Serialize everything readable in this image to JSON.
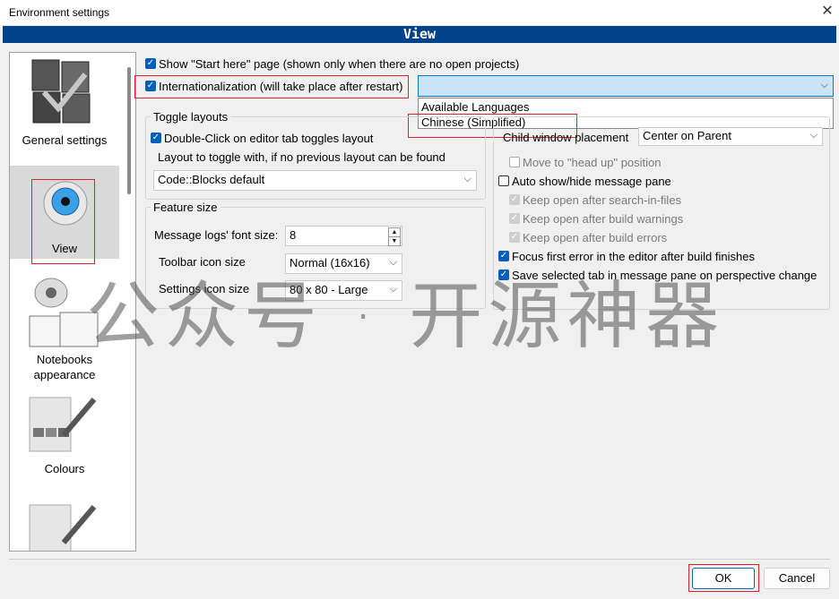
{
  "window": {
    "title": "Environment settings",
    "close_icon": "close-icon"
  },
  "header": {
    "title": "View"
  },
  "sidebar": {
    "items": [
      {
        "label": "General settings",
        "icon": "general-settings-icon"
      },
      {
        "label": "View",
        "icon": "eye-icon",
        "selected": true
      },
      {
        "label": "Notebooks appearance",
        "icon": "notebooks-icon"
      },
      {
        "label": "Colours",
        "icon": "palette-icon"
      },
      {
        "label": "",
        "icon": "palette-icon"
      }
    ]
  },
  "options": {
    "show_start_here": "Show \"Start here\" page (shown only when there are no open projects)",
    "internationalization": "Internationalization (will take place after restart)"
  },
  "language": {
    "selected": "",
    "dropdown_items": [
      "Available Languages",
      "Chinese (Simplified)"
    ]
  },
  "toggle_layouts": {
    "title": "Toggle layouts",
    "double_click": "Double-Click on editor tab toggles layout",
    "layout_hint": "Layout to toggle with, if no previous layout can be found",
    "layout_value": "Code::Blocks default"
  },
  "feature_size": {
    "title": "Feature size",
    "font_size_label": "Message logs' font size:",
    "font_size_value": "8",
    "toolbar_label": "Toolbar icon size",
    "toolbar_value": "Normal (16x16)",
    "settings_label": "Settings icon size",
    "settings_value": "80 x 80 - Large"
  },
  "right_panel": {
    "child_window_label": "Child window placement",
    "child_window_value": "Center on Parent",
    "move_head_up": "Move to \"head up\" position",
    "auto_show_hide": "Auto show/hide message pane",
    "keep_search": "Keep open after search-in-files",
    "keep_warnings": "Keep open after build warnings",
    "keep_errors": "Keep open after build errors",
    "focus_first_error": "Focus first error in the editor after build finishes",
    "save_selected_tab": "Save selected tab in message pane on perspective change"
  },
  "buttons": {
    "ok": "OK",
    "cancel": "Cancel"
  },
  "watermark": "公众号 · 开源神器",
  "colors": {
    "header_bg": "#00438a",
    "accent": "#005fb8",
    "highlight": "#e0202a"
  }
}
